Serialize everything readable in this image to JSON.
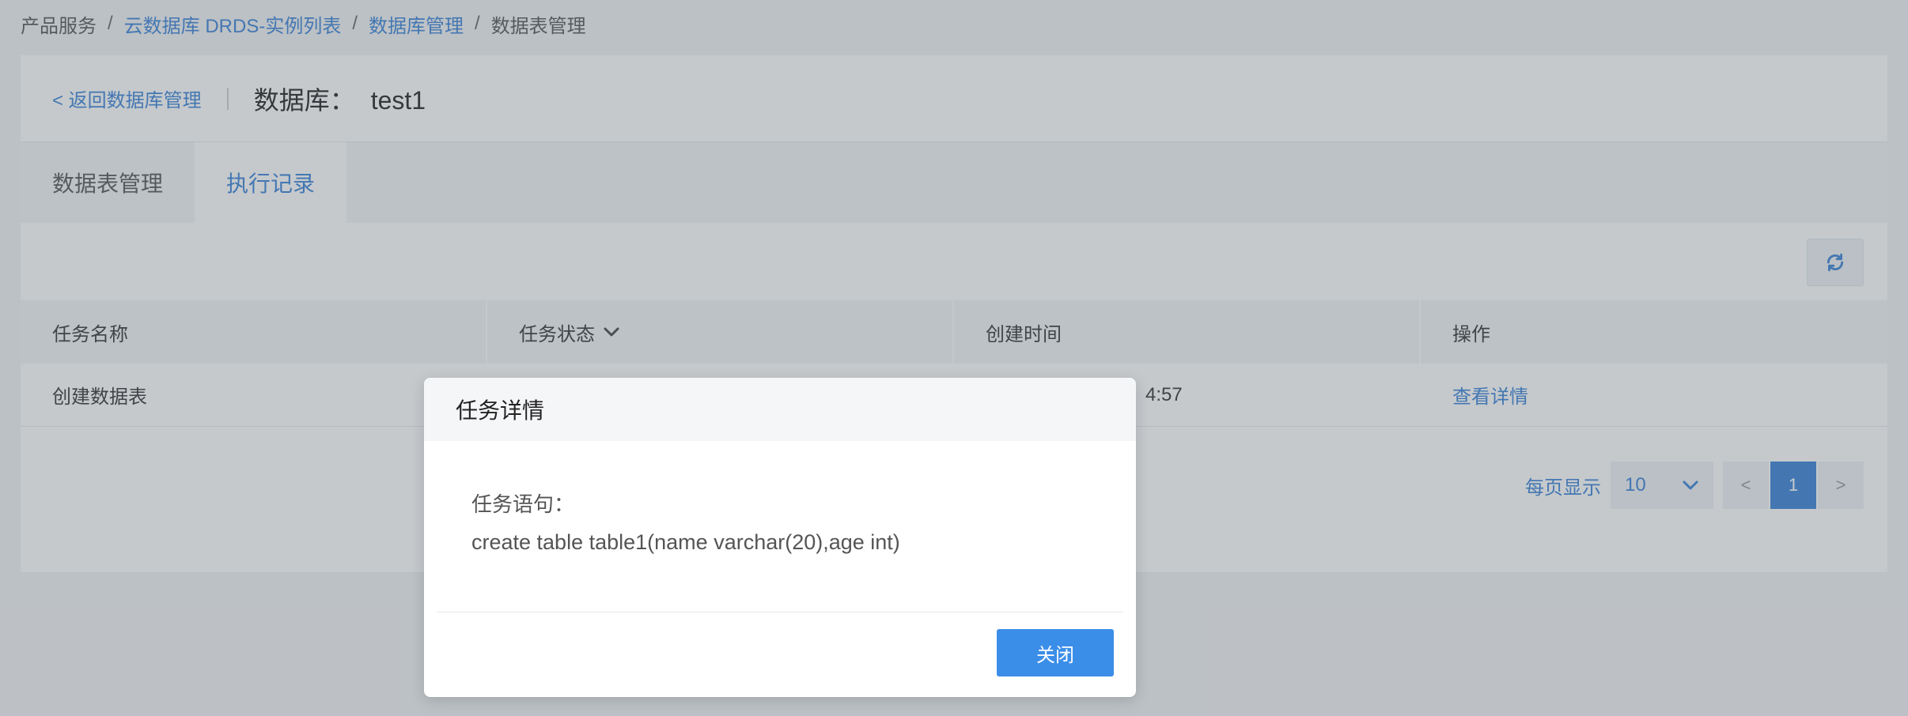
{
  "breadcrumb": {
    "items": [
      "产品服务",
      "云数据库 DRDS-实例列表",
      "数据库管理",
      "数据表管理"
    ],
    "separator": "/"
  },
  "header": {
    "back_label": "< 返回数据库管理",
    "db_label": "数据库：",
    "db_name": "test1"
  },
  "tabs": [
    {
      "label": "数据表管理",
      "active": false
    },
    {
      "label": "执行记录",
      "active": true
    }
  ],
  "toolbar": {
    "refresh_icon": "refresh-icon"
  },
  "table": {
    "columns": [
      "任务名称",
      "任务状态",
      "创建时间",
      "操作"
    ],
    "rows": [
      {
        "name": "创建数据表",
        "status": "",
        "created": "4:57",
        "action": "查看详情"
      }
    ]
  },
  "pagination": {
    "per_page_label": "每页显示",
    "per_page_value": "10",
    "prev": "<",
    "current": "1",
    "next": ">"
  },
  "modal": {
    "title": "任务详情",
    "statement_label": "任务语句：",
    "statement": "create table table1(name varchar(20),age int)",
    "close_label": "关闭"
  },
  "colors": {
    "accent": "#3a82d8",
    "primary_button": "#3b8ee8"
  }
}
